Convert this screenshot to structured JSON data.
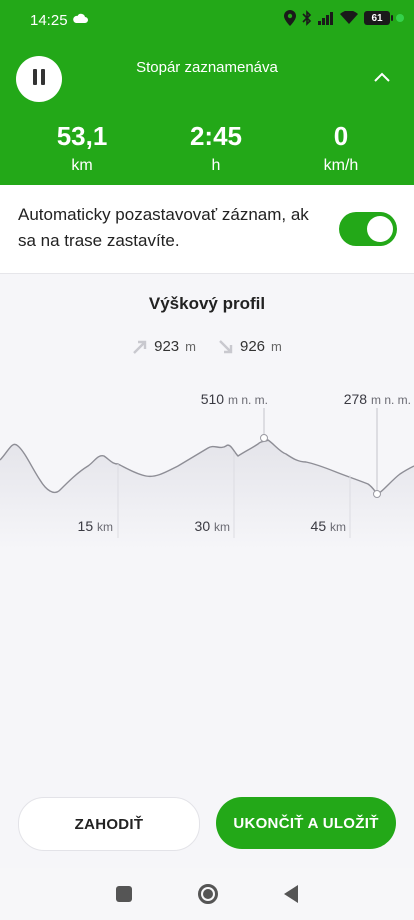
{
  "status_bar": {
    "time": "14:25",
    "battery": "61",
    "icons": [
      "cloud-icon",
      "location-icon",
      "bluetooth-icon",
      "signal-icon",
      "wifi-icon",
      "battery-icon"
    ]
  },
  "recording": {
    "title": "Stopár zaznamenáva",
    "stats": [
      {
        "value": "53,1",
        "unit": "km"
      },
      {
        "value": "2:45",
        "unit": "h"
      },
      {
        "value": "0",
        "unit": "km/h"
      }
    ]
  },
  "auto_pause": {
    "label": "Automaticky pozastavovať záznam, ak sa na trase zastavíte.",
    "enabled": true
  },
  "elevation": {
    "title": "Výškový profil",
    "ascent": {
      "value": "923",
      "unit": "m"
    },
    "descent": {
      "value": "926",
      "unit": "m"
    },
    "max": {
      "value": "510",
      "unit": "m n. m."
    },
    "min": {
      "value": "278",
      "unit": "m n. m."
    },
    "distance_ticks": [
      {
        "value": "15",
        "unit": "km"
      },
      {
        "value": "30",
        "unit": "km"
      },
      {
        "value": "45",
        "unit": "km"
      }
    ]
  },
  "buttons": {
    "discard": "ZAHODIŤ",
    "save": "UKONČIŤ A ULOŽIŤ"
  },
  "colors": {
    "accent": "#23a818",
    "background": "#f6f6f9"
  }
}
